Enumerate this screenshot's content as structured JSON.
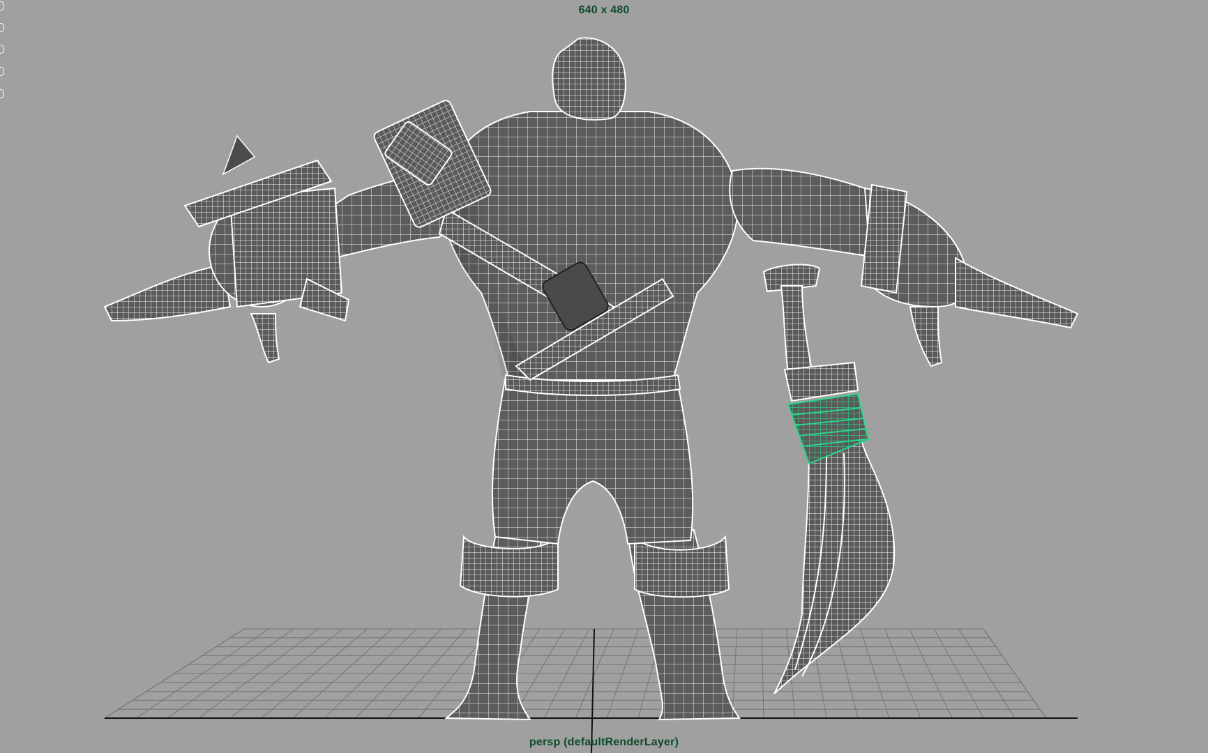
{
  "viewport": {
    "resolution_gate": "640 x 480",
    "camera_label": "persp (defaultRenderLayer)",
    "background_color": "#a0a0a0",
    "wire_color": "#ffffff",
    "selected_wire_color": "#2bd68a",
    "mesh_color": "#5c5c5c",
    "hud_text_color": "#0d4b2a"
  },
  "scene": {
    "objects": [
      {
        "name": "character-body-mesh",
        "state": "unselected"
      },
      {
        "name": "left-fist-mace",
        "state": "unselected"
      },
      {
        "name": "right-fist",
        "state": "unselected"
      },
      {
        "name": "shoulder-strap",
        "state": "unselected"
      },
      {
        "name": "curved-sword",
        "state": "unselected"
      },
      {
        "name": "sword-grip-wrap",
        "state": "selected"
      }
    ],
    "ground_grid": true
  }
}
